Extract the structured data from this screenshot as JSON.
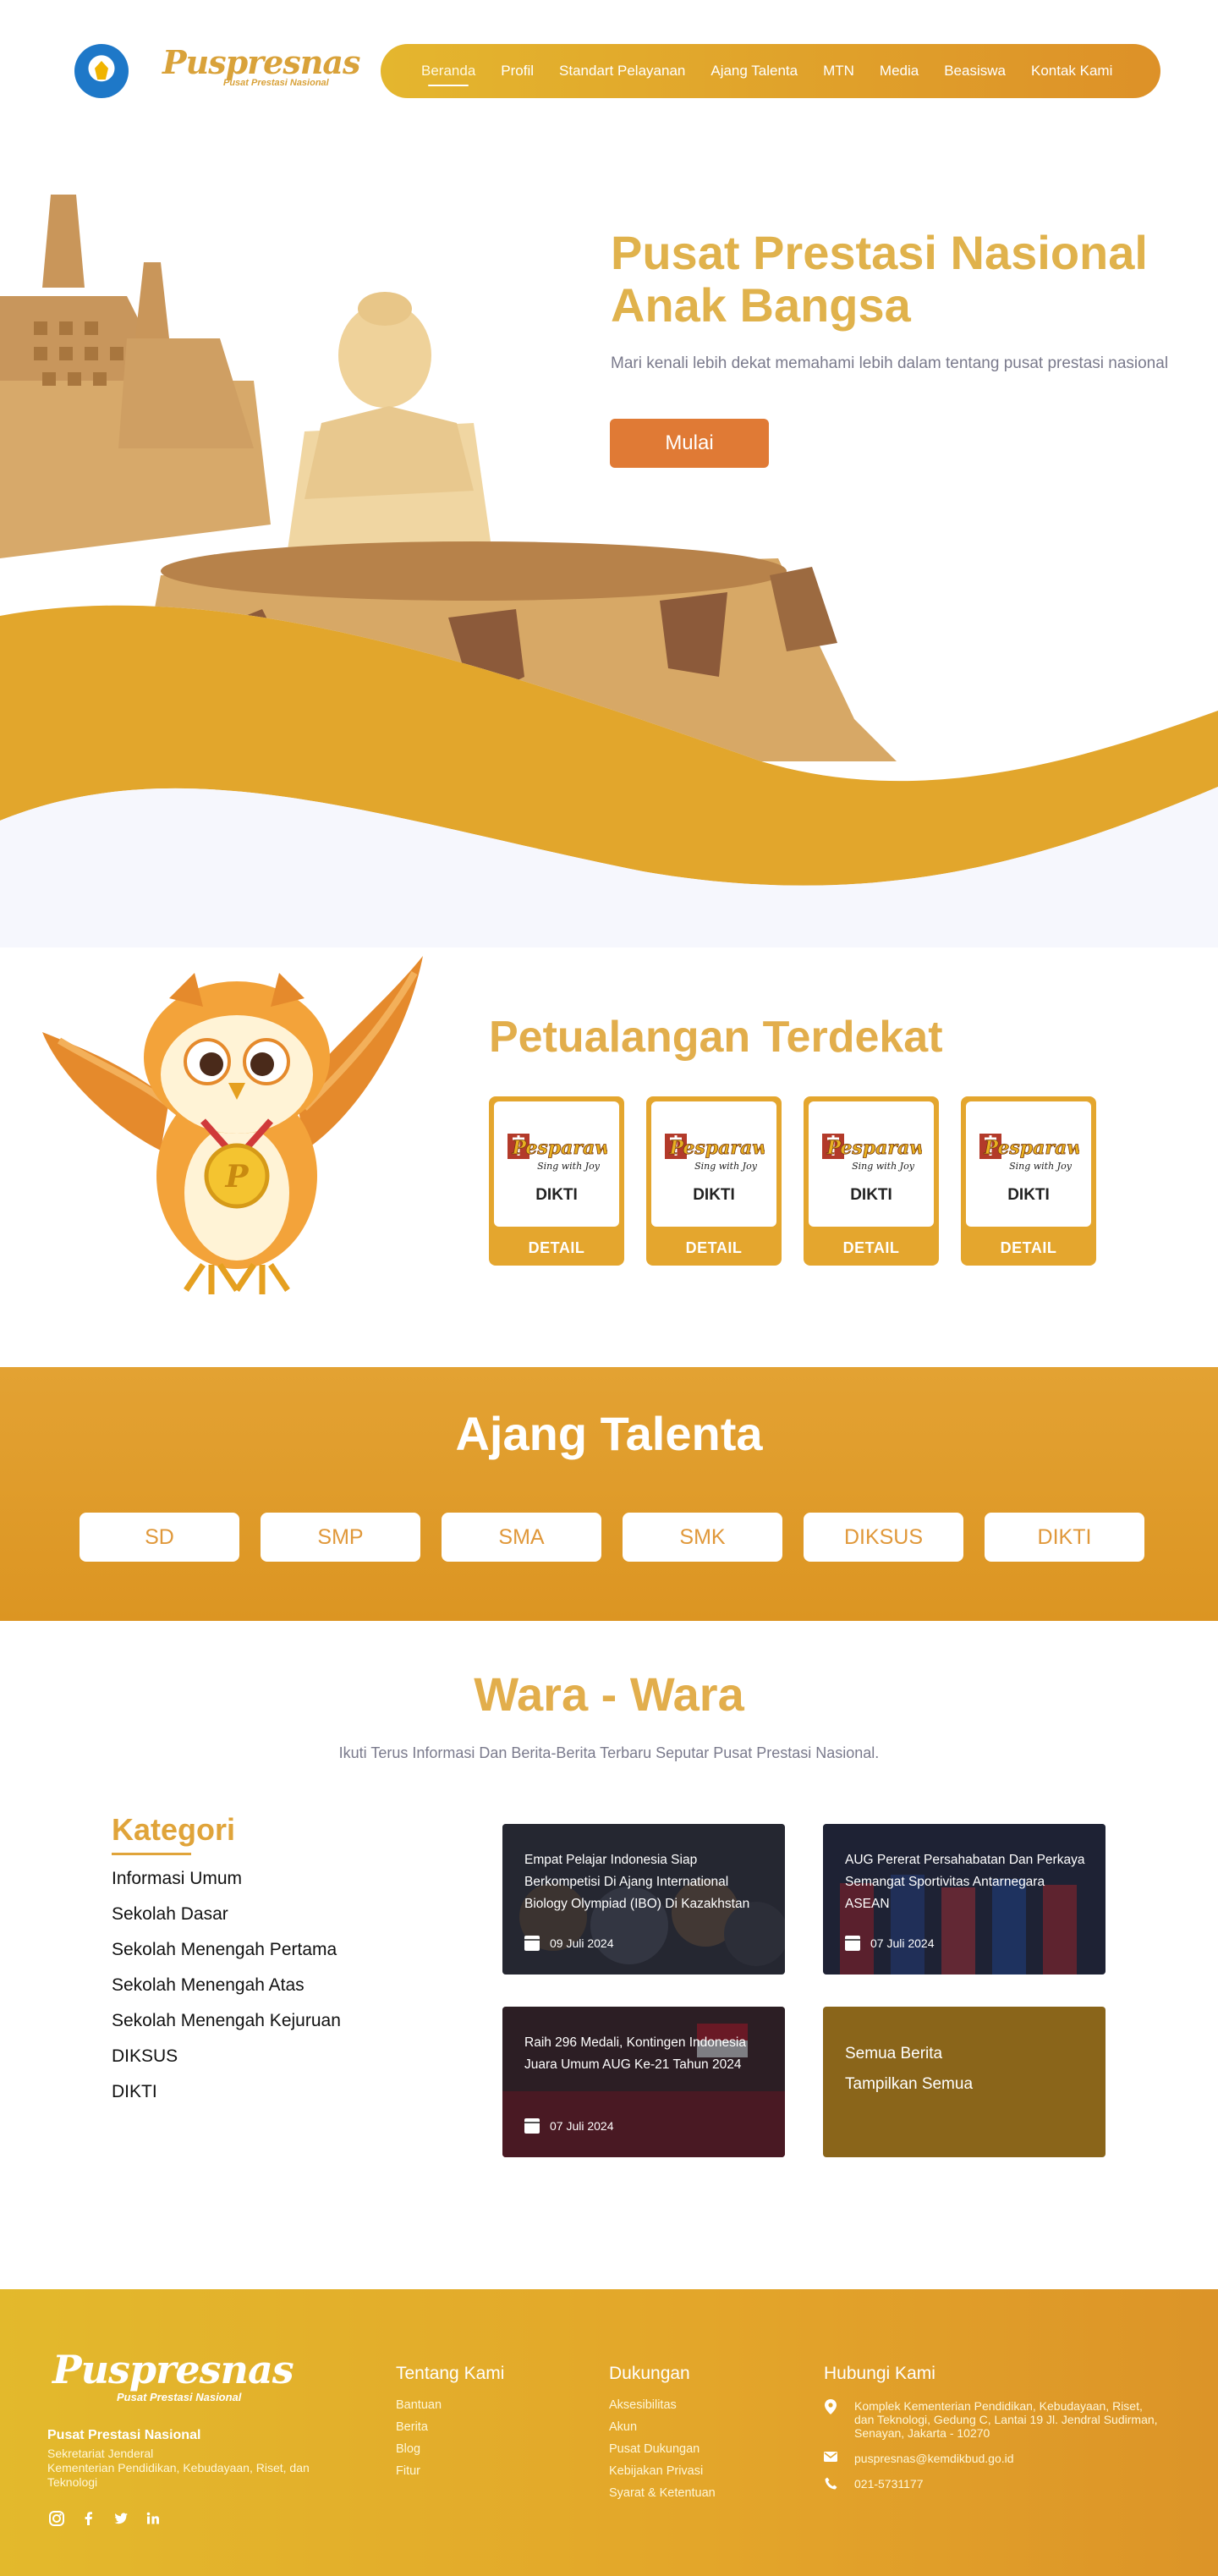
{
  "header": {
    "brand": "Puspresnas",
    "brand_sub": "Pusat Prestasi Nasional",
    "nav": [
      "Beranda",
      "Profil",
      "Standart Pelayanan",
      "Ajang Talenta",
      "MTN",
      "Media",
      "Beasiswa",
      "Kontak Kami"
    ]
  },
  "hero": {
    "title_line1": "Pusat Prestasi Nasional",
    "title_line2": "Anak Bangsa",
    "description": "Mari kenali lebih dekat memahami lebih dalam tentang pusat prestasi nasional",
    "button": "Mulai"
  },
  "petualangan": {
    "title": "Petualangan Terdekat",
    "cards": [
      {
        "label": "DIKTI",
        "detail": "DETAIL"
      },
      {
        "label": "DIKTI",
        "detail": "DETAIL"
      },
      {
        "label": "DIKTI",
        "detail": "DETAIL"
      },
      {
        "label": "DIKTI",
        "detail": "DETAIL"
      }
    ]
  },
  "talenta": {
    "title": "Ajang Talenta",
    "levels": [
      "SD",
      "SMP",
      "SMA",
      "SMK",
      "DIKSUS",
      "DIKTI"
    ]
  },
  "wara": {
    "title": "Wara - Wara",
    "subtitle": "Ikuti Terus Informasi Dan Berita-Berita Terbaru Seputar Pusat Prestasi Nasional.",
    "kategori_title": "Kategori",
    "kategori": [
      "Informasi Umum",
      "Sekolah Dasar",
      "Sekolah Menengah Pertama",
      "Sekolah Menengah Atas",
      "Sekolah Menengah Kejuruan",
      "DIKSUS",
      "DIKTI"
    ],
    "news": [
      {
        "title": "Empat Pelajar Indonesia Siap Berkompetisi Di Ajang International Biology Olympiad (IBO) Di Kazakhstan",
        "date": "09 Juli 2024"
      },
      {
        "title": "AUG Pererat Persahabatan Dan Perkaya Semangat Sportivitas Antarnegara ASEAN",
        "date": "07 Juli 2024"
      },
      {
        "title": "Raih 296 Medali, Kontingen Indonesia Juara Umum AUG Ke-21 Tahun 2024",
        "date": "07 Juli 2024"
      }
    ],
    "all_news_title": "Semua Berita",
    "all_news_link": "Tampilkan Semua"
  },
  "footer": {
    "brand": "Puspresnas",
    "brand_sub": "Pusat Prestasi Nasional",
    "org": "Pusat Prestasi Nasional",
    "org_sub1": "Sekretariat Jenderal",
    "org_sub2": "Kementerian Pendidikan, Kebudayaan, Riset, dan Teknologi",
    "tentang_title": "Tentang Kami",
    "tentang": [
      "Bantuan",
      "Berita",
      "Blog",
      "Fitur"
    ],
    "dukungan_title": "Dukungan",
    "dukungan": [
      "Aksesibilitas",
      "Akun",
      "Pusat Dukungan",
      "Kebijakan Privasi",
      "Syarat & Ketentuan"
    ],
    "kontak_title": "Hubungi Kami",
    "address": "Komplek Kementerian Pendidikan, Kebudayaan, Riset, dan Teknologi, Gedung C, Lantai 19 Jl. Jendral Sudirman, Senayan, Jakarta - 10270",
    "email": "puspresnas@kemdikbud.go.id",
    "phone": "021-5731177"
  }
}
